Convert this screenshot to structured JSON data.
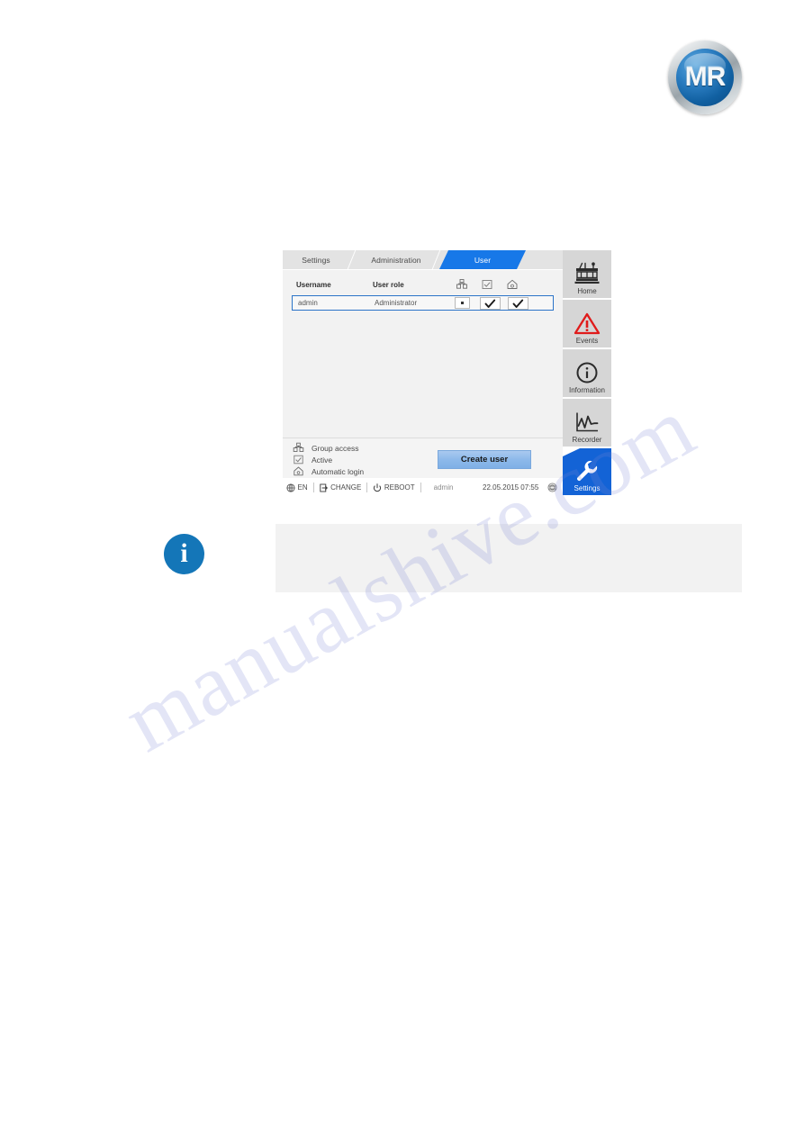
{
  "logo": {
    "text": "MR",
    "ring_color": "#9aa3a9",
    "disc_color": "#1160a1"
  },
  "hmi": {
    "tabs": [
      {
        "label": "Settings",
        "active": false
      },
      {
        "label": "Administration",
        "active": false
      },
      {
        "label": "User",
        "active": true
      }
    ],
    "active_tab_color": "#1778e8",
    "table": {
      "columns": [
        {
          "label": "Username",
          "type": "text"
        },
        {
          "label": "User role",
          "type": "text"
        },
        {
          "label": "",
          "icon": "group-access-icon"
        },
        {
          "label": "",
          "icon": "active-checkbox-icon"
        },
        {
          "label": "",
          "icon": "automatic-login-icon"
        }
      ],
      "rows": [
        {
          "username": "admin",
          "role": "Administrator",
          "group_access": "•",
          "active": "checked",
          "automatic_login": "checked",
          "selected": true
        }
      ]
    },
    "legend": [
      {
        "icon": "group-access-icon",
        "label": "Group access"
      },
      {
        "icon": "active-checkbox-icon",
        "label": "Active"
      },
      {
        "icon": "automatic-login-icon",
        "label": "Automatic login"
      }
    ],
    "create_user_label": "Create user",
    "status_bar": {
      "language": "EN",
      "change_label": "CHANGE",
      "reboot_label": "REBOOT",
      "user": "admin",
      "datetime": "22.05.2015 07:55"
    },
    "sidebar": [
      {
        "label": "Home",
        "icon": "transformer-icon",
        "active": false
      },
      {
        "label": "Events",
        "icon": "warning-triangle-icon",
        "active": false
      },
      {
        "label": "Information",
        "icon": "info-circle-icon",
        "active": false
      },
      {
        "label": "Recorder",
        "icon": "chart-recorder-icon",
        "active": false
      },
      {
        "label": "Settings",
        "icon": "wrench-icon",
        "active": true
      }
    ]
  },
  "callout": {
    "icon": "info-icon",
    "note_text": ""
  },
  "watermark": {
    "text": "manualshive.com"
  }
}
